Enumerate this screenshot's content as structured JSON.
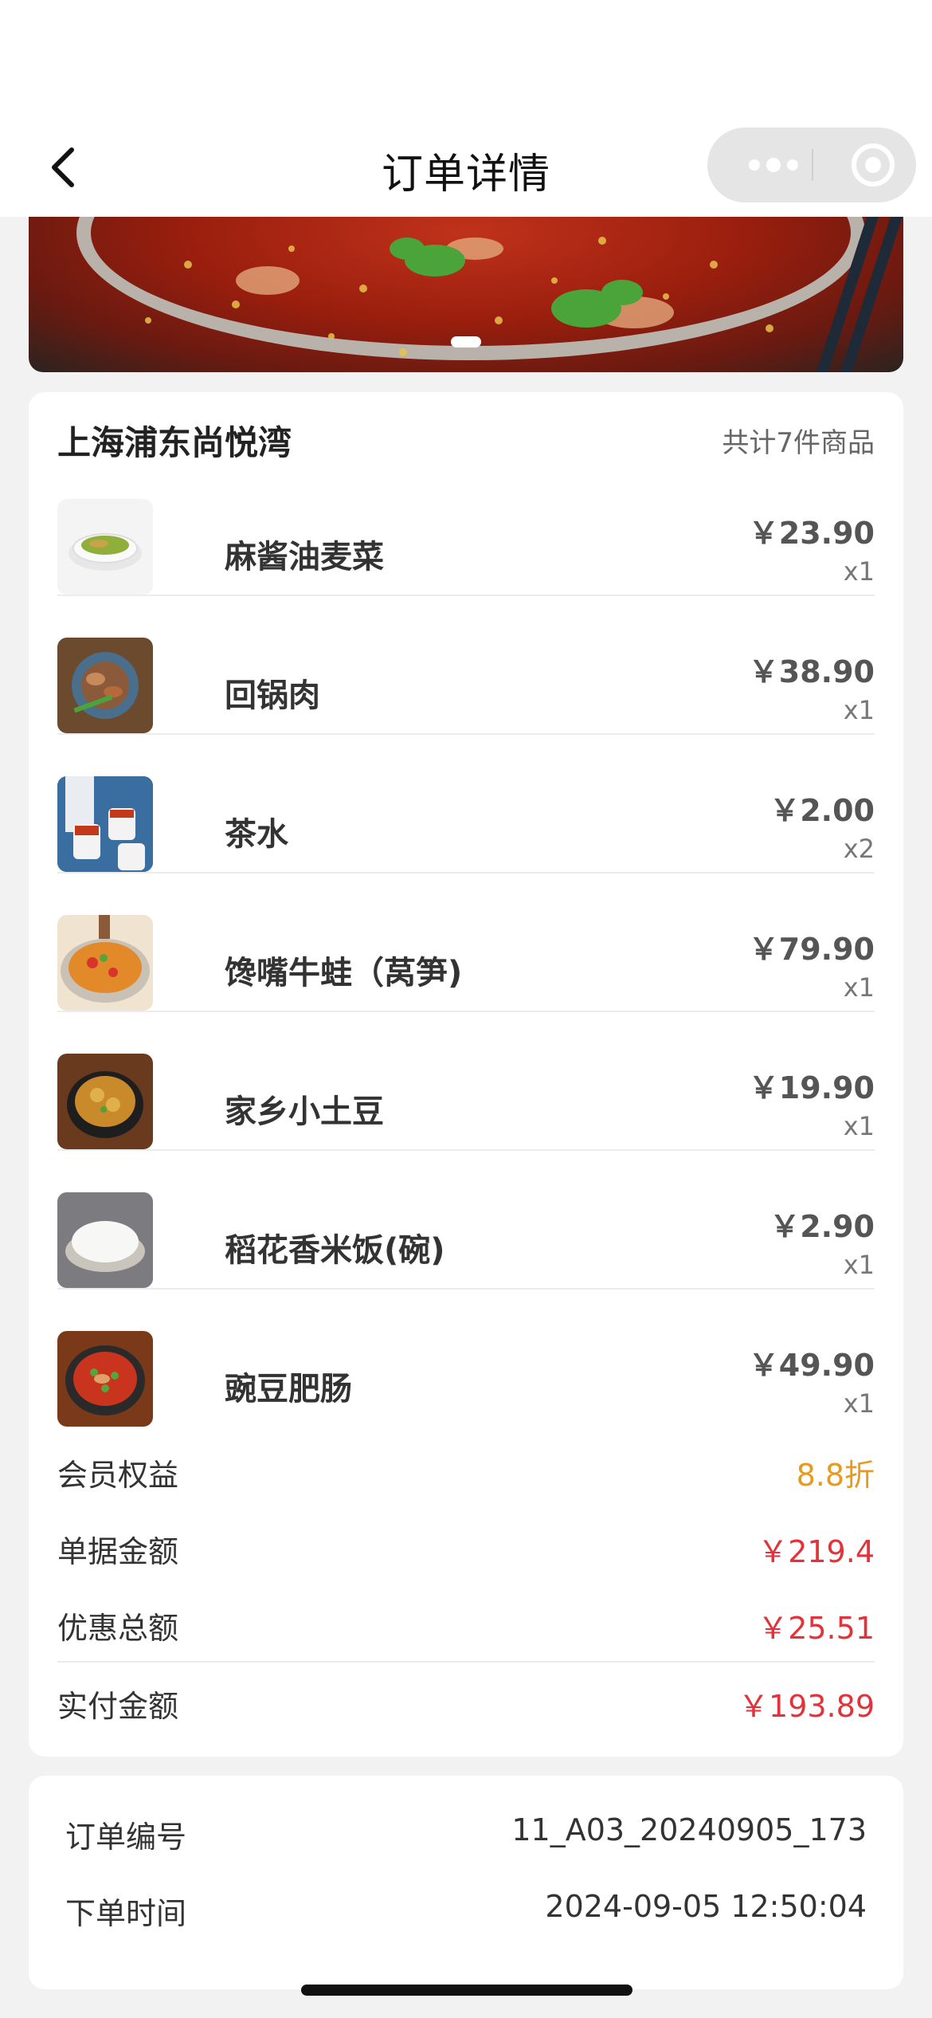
{
  "header": {
    "title": "订单详情"
  },
  "store": {
    "name": "上海浦东尚悦湾",
    "item_count": "共计7件商品"
  },
  "items": [
    {
      "name": "麻酱油麦菜",
      "price": "￥23.90",
      "qty": "x1"
    },
    {
      "name": "回锅肉",
      "price": "￥38.90",
      "qty": "x1"
    },
    {
      "name": "茶水",
      "price": "￥2.00",
      "qty": "x2"
    },
    {
      "name": "馋嘴牛蛙（莴笋)",
      "price": "￥79.90",
      "qty": "x1"
    },
    {
      "name": "家乡小土豆",
      "price": "￥19.90",
      "qty": "x1"
    },
    {
      "name": "稻花香米饭(碗)",
      "price": "￥2.90",
      "qty": "x1"
    },
    {
      "name": "豌豆肥肠",
      "price": "￥49.90",
      "qty": "x1"
    }
  ],
  "summary": {
    "member_label": "会员权益",
    "member_value": "8.8折",
    "bill_label": "单据金额",
    "bill_value": "￥219.4",
    "discount_label": "优惠总额",
    "discount_value": "￥25.51",
    "paid_label": "实付金额",
    "paid_value": "￥193.89"
  },
  "order_info": {
    "number_label": "订单编号",
    "number_value": "11_A03_20240905_173",
    "time_label": "下单时间",
    "time_value": "2024-09-05 12:50:04"
  },
  "colors": {
    "accent_orange": "#e89a1e",
    "accent_red": "#e2333a"
  },
  "icons": {
    "back": "chevron-left-icon",
    "more": "more-dots-icon",
    "close_target": "target-circle-icon"
  }
}
